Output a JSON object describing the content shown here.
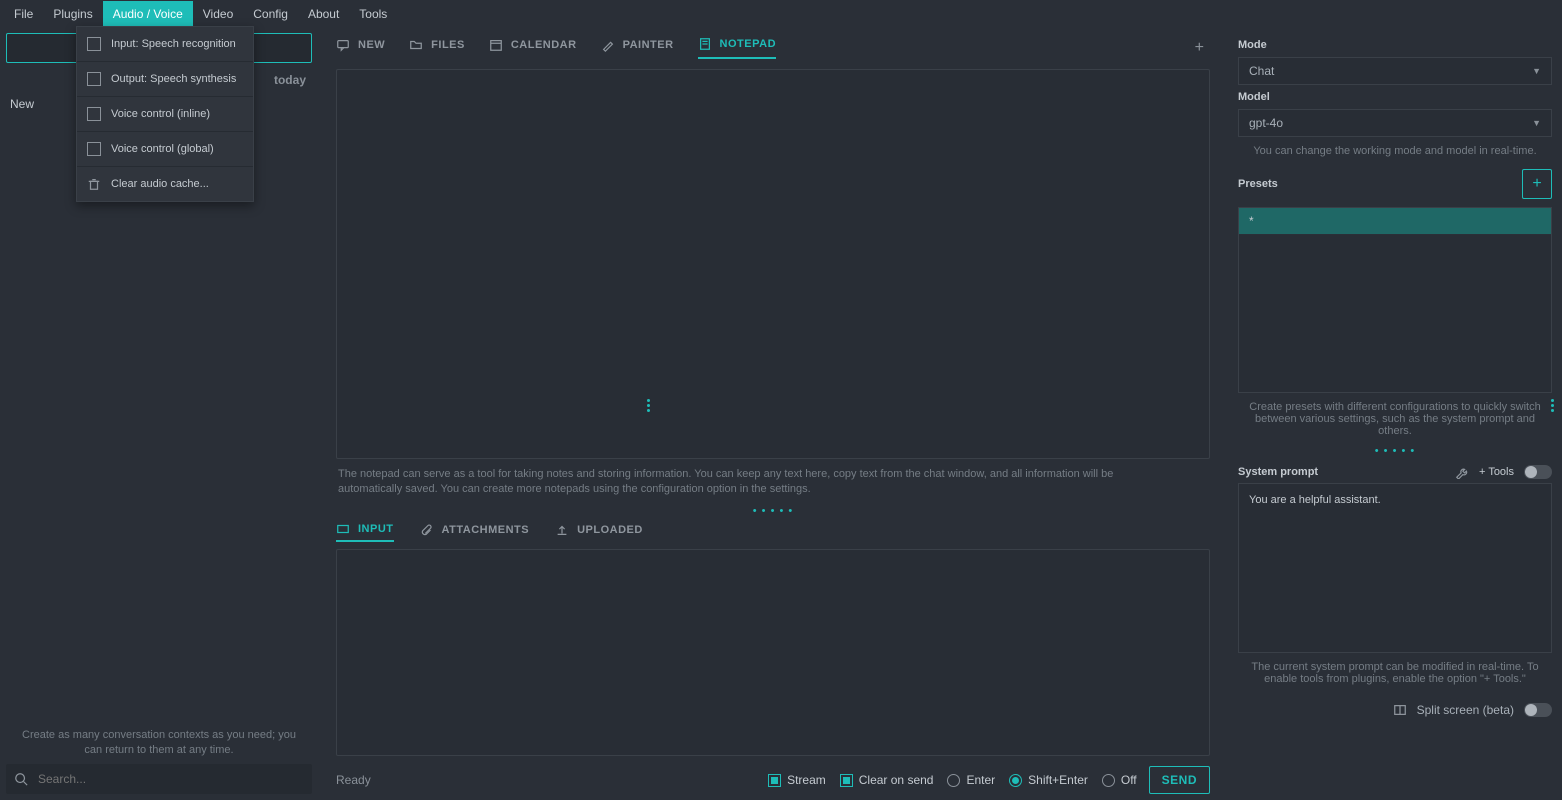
{
  "menubar": [
    "File",
    "Plugins",
    "Audio / Voice",
    "Video",
    "Config",
    "About",
    "Tools"
  ],
  "menubar_active_index": 2,
  "dropdown": {
    "items": [
      {
        "label": "Input: Speech recognition",
        "type": "check"
      },
      {
        "label": "Output: Speech synthesis",
        "type": "check"
      },
      {
        "label": "Voice control (inline)",
        "type": "check"
      },
      {
        "label": "Voice control (global)",
        "type": "check"
      },
      {
        "label": "Clear audio cache...",
        "type": "action"
      }
    ]
  },
  "left": {
    "date_label": "today",
    "item": "New",
    "hint": "Create as many conversation contexts as you need; you can return to them at any time.",
    "search_placeholder": "Search..."
  },
  "center": {
    "tabs": [
      "NEW",
      "FILES",
      "CALENDAR",
      "PAINTER",
      "NOTEPAD"
    ],
    "active_tab_index": 4,
    "notepad_hint": "The notepad can serve as a tool for taking notes and storing information. You can keep any text here, copy text from the chat window, and all information will be automatically saved. You can create more notepads using the configuration option in the settings.",
    "input_tabs": [
      "INPUT",
      "ATTACHMENTS",
      "UPLOADED"
    ],
    "active_input_tab_index": 0,
    "status": "Ready",
    "options": {
      "stream": {
        "label": "Stream",
        "checked": true
      },
      "clear_on_send": {
        "label": "Clear on send",
        "checked": true
      },
      "enter": {
        "label": "Enter",
        "selected": false
      },
      "shift_enter": {
        "label": "Shift+Enter",
        "selected": true
      },
      "off": {
        "label": "Off",
        "selected": false
      }
    },
    "send_label": "SEND"
  },
  "right": {
    "mode_label": "Mode",
    "mode_value": "Chat",
    "model_label": "Model",
    "model_value": "gpt-4o",
    "mode_hint": "You can change the working mode and model in real-time.",
    "presets_label": "Presets",
    "preset_item": "*",
    "presets_hint": "Create presets with different configurations to quickly switch between various settings, such as the system prompt and others.",
    "system_prompt_label": "System prompt",
    "plus_tools_label": "+ Tools",
    "system_prompt_value": "You are a helpful assistant.",
    "system_prompt_hint": "The current system prompt can be modified in real-time. To enable tools from plugins, enable the option \"+ Tools.\"",
    "split_screen_label": "Split screen (beta)"
  }
}
